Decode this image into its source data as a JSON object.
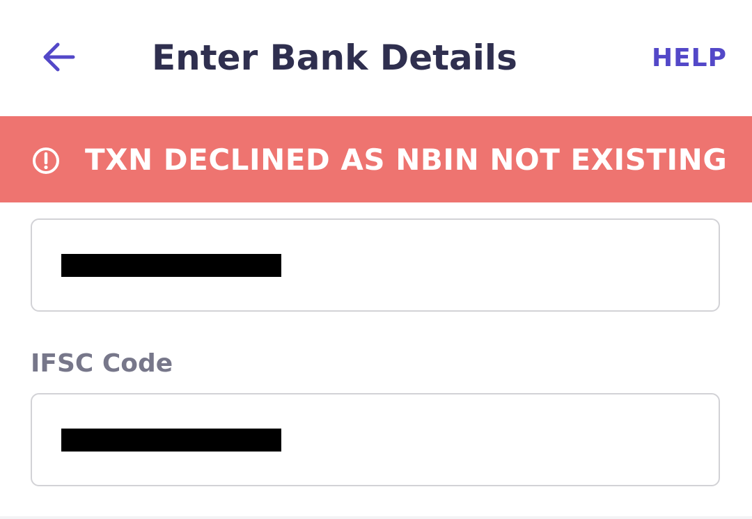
{
  "header": {
    "title": "Enter Bank Details",
    "help_label": "HELP",
    "back_icon": "arrow-left-icon"
  },
  "error_banner": {
    "message": "TXN DECLINED AS NBIN NOT EXISTING",
    "icon": "alert-circle-icon"
  },
  "form": {
    "account_field": {
      "value": "",
      "redacted": true
    },
    "ifsc_field": {
      "label": "IFSC Code",
      "value": "",
      "redacted": true
    }
  },
  "colors": {
    "accent": "#5348c8",
    "title": "#2f2f4f",
    "error_bg": "#ee7470",
    "label": "#77778a",
    "field_border": "#d2d2d6"
  }
}
